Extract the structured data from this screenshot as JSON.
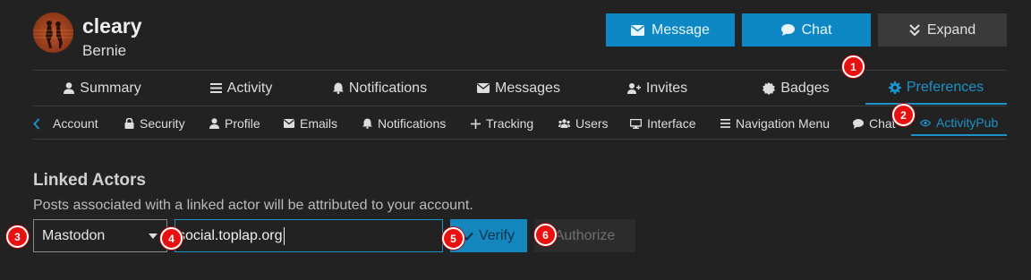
{
  "user": {
    "username": "cleary",
    "full_name": "Bernie"
  },
  "header_buttons": {
    "message": "Message",
    "chat": "Chat",
    "expand": "Expand"
  },
  "main_nav": [
    {
      "label": "Summary",
      "icon": "user-icon"
    },
    {
      "label": "Activity",
      "icon": "list-icon"
    },
    {
      "label": "Notifications",
      "icon": "bell-icon"
    },
    {
      "label": "Messages",
      "icon": "envelope-icon"
    },
    {
      "label": "Invites",
      "icon": "user-plus-icon"
    },
    {
      "label": "Badges",
      "icon": "badge-icon"
    },
    {
      "label": "Preferences",
      "icon": "gear-icon",
      "active": true
    }
  ],
  "sub_nav": [
    {
      "label": "Account",
      "icon": "chevron-left-icon"
    },
    {
      "label": "Security",
      "icon": "lock-icon"
    },
    {
      "label": "Profile",
      "icon": "user-icon"
    },
    {
      "label": "Emails",
      "icon": "envelope-icon"
    },
    {
      "label": "Notifications",
      "icon": "bell-icon"
    },
    {
      "label": "Tracking",
      "icon": "plus-icon"
    },
    {
      "label": "Users",
      "icon": "users-icon"
    },
    {
      "label": "Interface",
      "icon": "desktop-icon"
    },
    {
      "label": "Navigation Menu",
      "icon": "bars-icon"
    },
    {
      "label": "Chat",
      "icon": "comment-icon"
    },
    {
      "label": "ActivityPub",
      "icon": "eye-icon",
      "active": true
    }
  ],
  "linked_actors": {
    "title": "Linked Actors",
    "description": "Posts associated with a linked actor will be attributed to your account.",
    "platform_value": "Mastodon",
    "domain_value": "social.toplap.org",
    "verify_label": "Verify",
    "authorize_label": "Authorize"
  },
  "markers": [
    "1",
    "2",
    "3",
    "4",
    "5",
    "6"
  ],
  "colors": {
    "background": "#222222",
    "accent": "#1b93c9",
    "primary_button": "#0e88c4",
    "secondary_button": "#3a3a3a",
    "marker": "#e8110f"
  }
}
